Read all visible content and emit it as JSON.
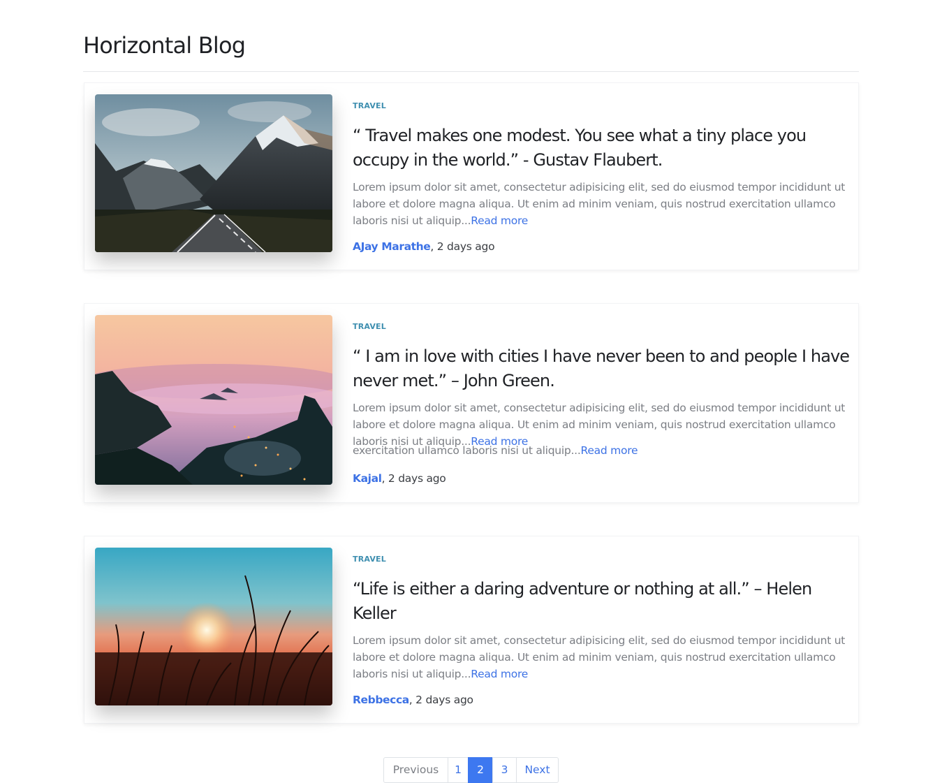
{
  "page": {
    "title": "Horizontal Blog"
  },
  "posts": [
    {
      "category": "TRAVEL",
      "headline": "“ Travel makes one modest. You see what a tiny place you occupy in the world.” - Gustav Flaubert.",
      "excerpt": "Lorem ipsum dolor sit amet, consectetur adipisicing elit, sed do eiusmod tempor incididunt ut labore et dolore magna aliqua. Ut enim ad minim veniam, quis nostrud exercitation ullamco laboris nisi ut aliquip...",
      "read_more": "Read more",
      "author": "AJay Marathe",
      "time": ", 2 days ago",
      "image": "mountain-road"
    },
    {
      "category": "TRAVEL",
      "headline": "“ I am in love with cities I have never been to and people I have never met.” – John Green.",
      "excerpt": "Lorem ipsum dolor sit amet, consectetur adipisicing elit, sed do eiusmod tempor incididunt ut labore et dolore magna aliqua. Ut enim ad minim veniam, quis nostrud exercitation ullamco laboris nisi ut aliquip...",
      "excerpt_overflow": "exercitation ullamco laboris nisi ut aliquip...",
      "read_more": "Read more",
      "author": "Kajal",
      "time": ", 2 days ago",
      "image": "misty-valley-sunset"
    },
    {
      "category": "TRAVEL",
      "headline": "“Life is either a daring adventure or nothing at all.” – Helen Keller",
      "excerpt": "Lorem ipsum dolor sit amet, consectetur adipisicing elit, sed do eiusmod tempor incididunt ut labore et dolore magna aliqua. Ut enim ad minim veniam, quis nostrud exercitation ullamco laboris nisi ut aliquip...",
      "read_more": "Read more",
      "author": "Rebbecca",
      "time": ", 2 days ago",
      "image": "sunset-plants"
    }
  ],
  "pagination": {
    "previous": "Previous",
    "pages": [
      "1",
      "2",
      "3"
    ],
    "active": "2",
    "next": "Next"
  },
  "colors": {
    "link": "#3d72e5",
    "category": "#3f8fb0",
    "active_page": "#3d78f0",
    "muted_text": "#7b7e84"
  }
}
